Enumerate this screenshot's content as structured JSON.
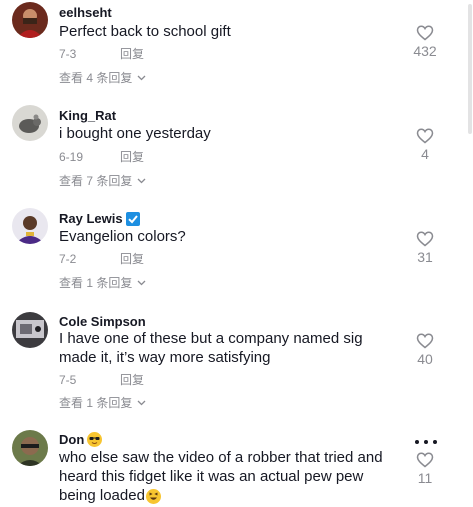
{
  "comments": [
    {
      "username": "eelhseht",
      "text": "Perfect back to school gift",
      "date": "7-3",
      "reply_label": "回复",
      "view_replies": "查看 4 条回复",
      "likes": "432"
    },
    {
      "username": "King_Rat",
      "text": "i bought one yesterday",
      "date": "6-19",
      "reply_label": "回复",
      "view_replies": "查看 7 条回复",
      "likes": "4"
    },
    {
      "username": "Ray Lewis",
      "text": "Evangelion colors?",
      "date": "7-2",
      "reply_label": "回复",
      "view_replies": "查看 1 条回复",
      "likes": "31"
    },
    {
      "username": "Cole Simpson",
      "text": "I have one of these but a company named sig made it, it’s way more satisfying",
      "date": "7-5",
      "reply_label": "回复",
      "view_replies": "查看 1 条回复",
      "likes": "40"
    },
    {
      "username": "Don",
      "text": "who else saw the video of a robber that tried and heard this fidget like it was an actual pew pew being loaded",
      "likes": "11"
    }
  ],
  "icons": {
    "like": "heart-outline-icon",
    "expand": "chevron-down-icon",
    "verified": "checkmark-badge-icon",
    "more": "more-horizontal-icon"
  },
  "colors": {
    "text_primary": "#161823",
    "text_secondary": "#8a8b91",
    "verified_badge": "#1d8fe1"
  }
}
